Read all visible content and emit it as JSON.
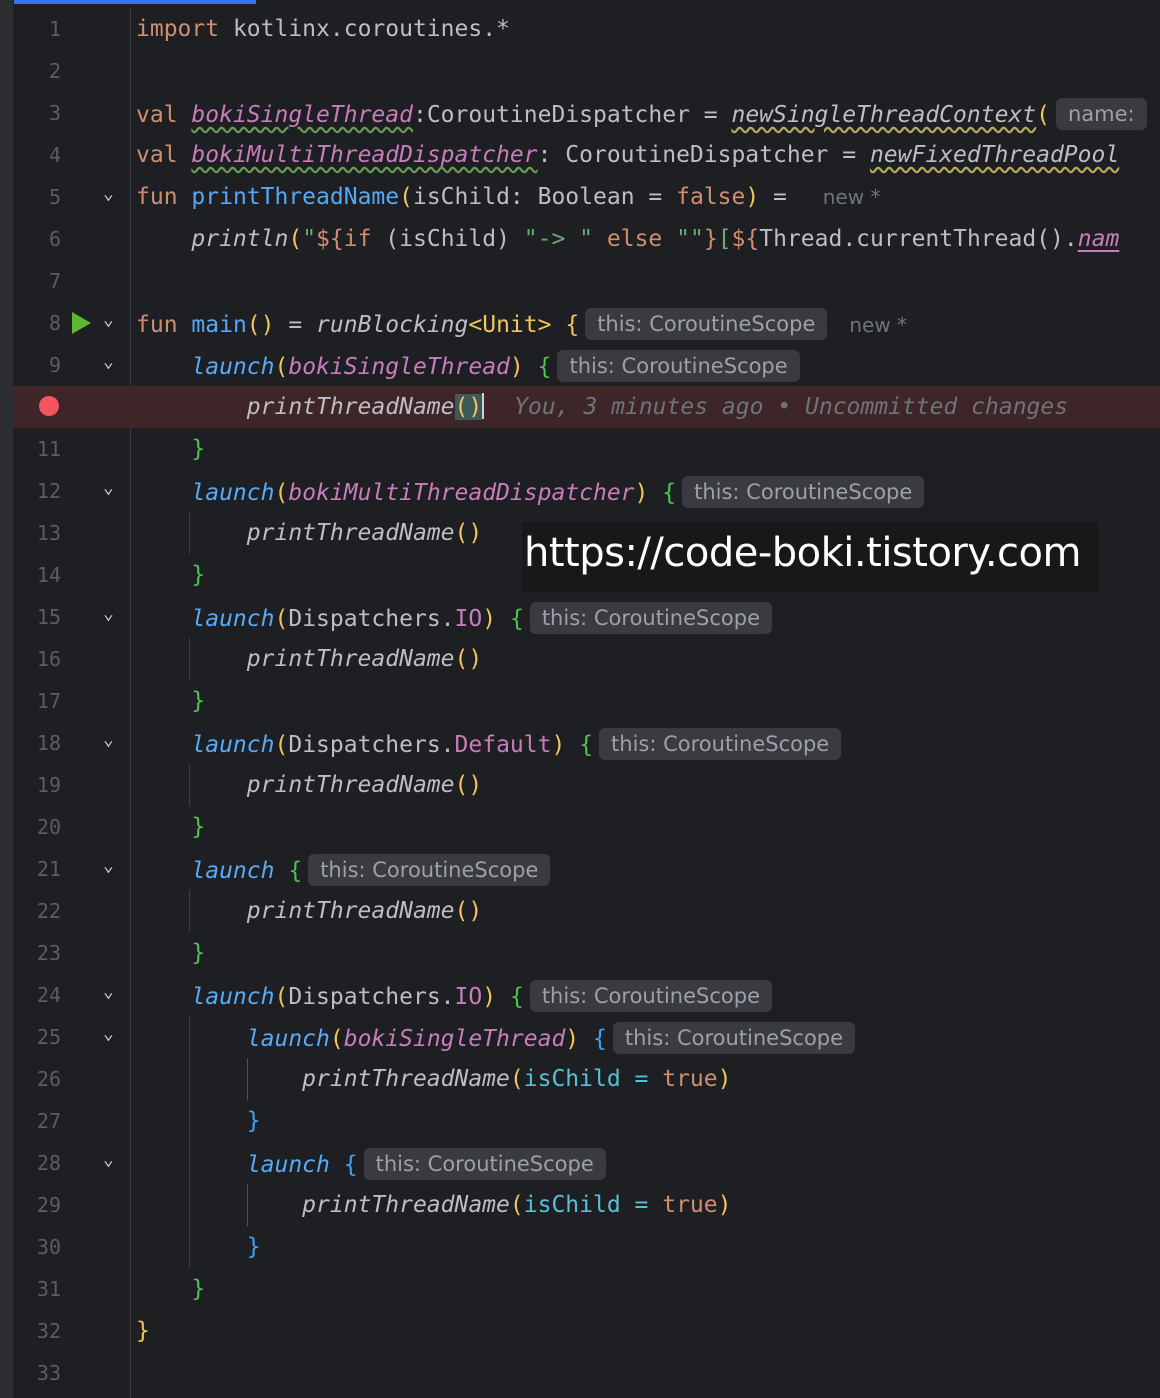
{
  "editor": {
    "lines": [
      {
        "n": "1"
      },
      {
        "n": "2"
      },
      {
        "n": "3"
      },
      {
        "n": "4"
      },
      {
        "n": "5"
      },
      {
        "n": "6"
      },
      {
        "n": "7"
      },
      {
        "n": "8"
      },
      {
        "n": "9"
      },
      {
        "n": "10"
      },
      {
        "n": "11"
      },
      {
        "n": "12"
      },
      {
        "n": "13"
      },
      {
        "n": "14"
      },
      {
        "n": "15"
      },
      {
        "n": "16"
      },
      {
        "n": "17"
      },
      {
        "n": "18"
      },
      {
        "n": "19"
      },
      {
        "n": "20"
      },
      {
        "n": "21"
      },
      {
        "n": "22"
      },
      {
        "n": "23"
      },
      {
        "n": "24"
      },
      {
        "n": "25"
      },
      {
        "n": "26"
      },
      {
        "n": "27"
      },
      {
        "n": "28"
      },
      {
        "n": "29"
      },
      {
        "n": "30"
      },
      {
        "n": "31"
      },
      {
        "n": "32"
      },
      {
        "n": "33"
      }
    ],
    "tok": {
      "import": "import",
      "import_path": " kotlinx.coroutines.*",
      "val": "val",
      "fun": "fun",
      "sp": " ",
      "indent1": "    ",
      "indent2": "        ",
      "indent3": "            ",
      "bokiSingleThread": "bokiSingleThread",
      "bokiMultiThreadDispatcher": "bokiMultiThreadDispatcher",
      "colon_type_nospace": ":CoroutineDispatcher = ",
      "colon_type": ": CoroutineDispatcher = ",
      "newSingleThreadContext": "newSingleThreadContext",
      "newFixedThreadPool": "newFixedThreadPool",
      "open_paren": "(",
      "close_paren": ")",
      "parens": "()",
      "printThreadName": "printThreadName",
      "sig_params": "isChild: Boolean = ",
      "false": "false",
      "true": "true",
      "eq": " = ",
      "println": "println",
      "str_open": "\"",
      "dollar_brace": "${",
      "if": "if",
      "ischild_paren": " (isChild) ",
      "str_arrow": "\"-> \"",
      "else": " else ",
      "str_empty": "\"\"",
      "close_br": "}",
      "bracket_open": "[",
      "thread_current": "Thread.currentThread()",
      "dot": ".",
      "nam": "nam",
      "main": "main",
      "runBlocking": "runBlocking",
      "unit_generic": "<Unit>",
      "open_brace": "{",
      "close_brace": "}",
      "launch": "launch",
      "dispatchers": "Dispatchers",
      "io": "IO",
      "default": "Default",
      "isChild": "isChild",
      "named_eq": " = "
    },
    "hints": {
      "scope": "this: CoroutineScope",
      "name_param": "name:",
      "new_author": "new *"
    },
    "blame": "You, 3 minutes ago • Uncommitted changes",
    "watermark": "https://code-boki.tistory.com"
  },
  "colors": {
    "background": "#1e1f22",
    "keyword": "#cf8e6d",
    "function": "#56a8f5",
    "property": "#c77dbb",
    "string": "#6aab73",
    "breakpoint": "#f4545b",
    "run": "#5fb832",
    "current_line": "#3e2527"
  }
}
